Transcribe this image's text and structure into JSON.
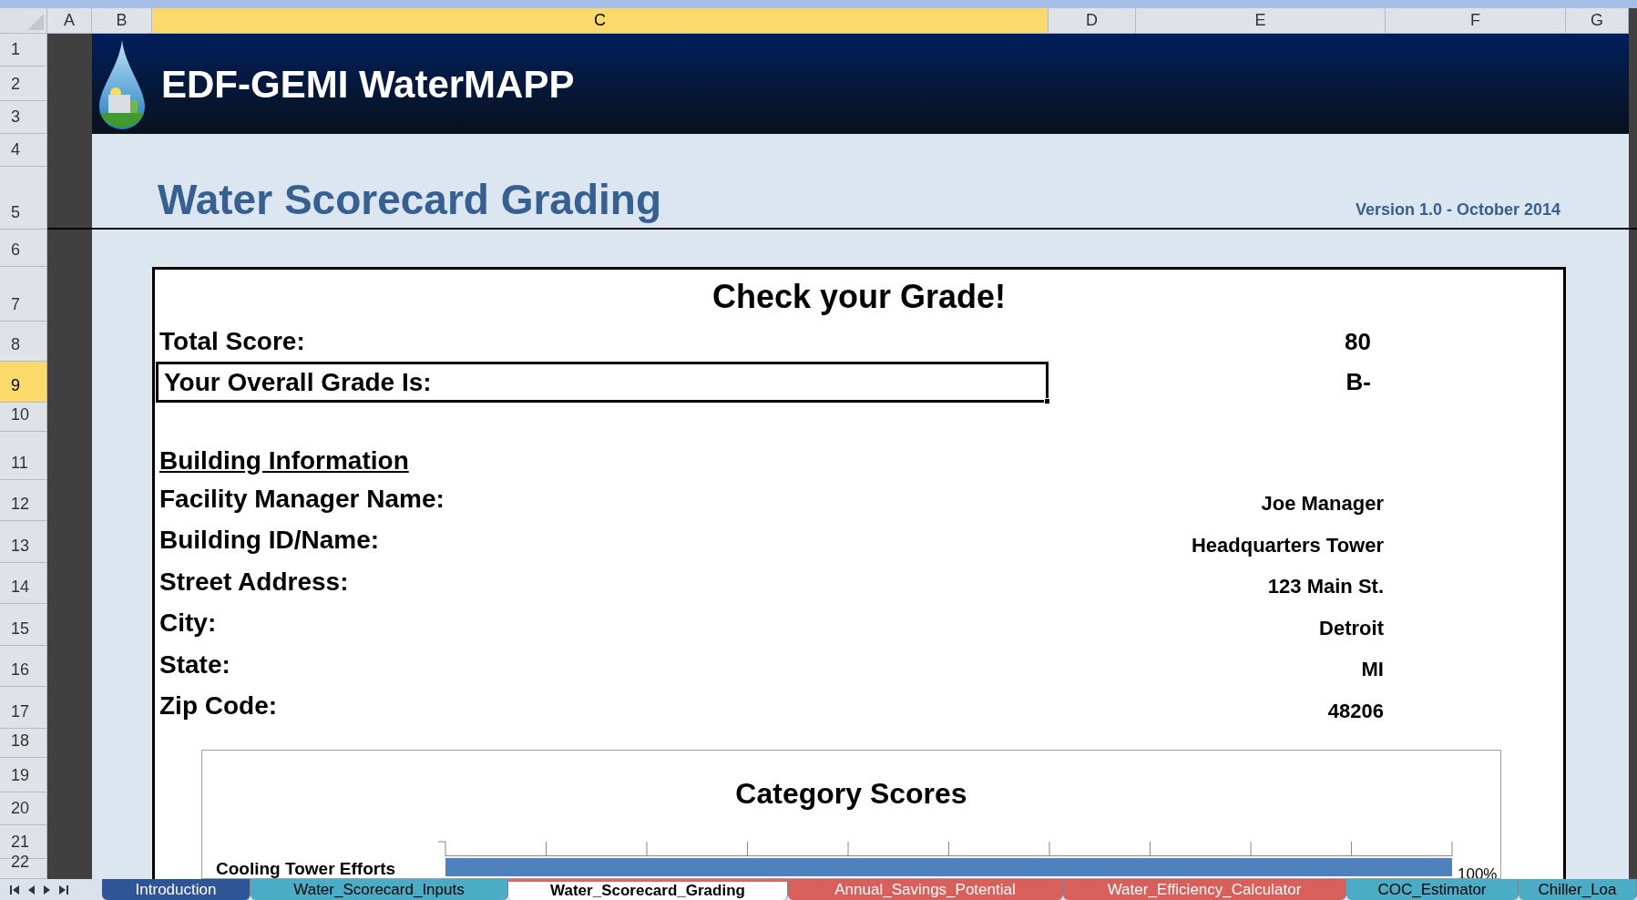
{
  "columns": [
    {
      "label": "A",
      "selected": false
    },
    {
      "label": "B",
      "selected": false
    },
    {
      "label": "C",
      "selected": true
    },
    {
      "label": "D",
      "selected": false
    },
    {
      "label": "E",
      "selected": false
    },
    {
      "label": "F",
      "selected": false
    },
    {
      "label": "G",
      "selected": false
    }
  ],
  "rows": [
    {
      "label": "1",
      "selected": false
    },
    {
      "label": "2",
      "selected": false
    },
    {
      "label": "3",
      "selected": false
    },
    {
      "label": "4",
      "selected": false
    },
    {
      "label": "5",
      "selected": false
    },
    {
      "label": "6",
      "selected": false
    },
    {
      "label": "7",
      "selected": false
    },
    {
      "label": "8",
      "selected": false
    },
    {
      "label": "9",
      "selected": true
    },
    {
      "label": "10",
      "selected": false
    },
    {
      "label": "11",
      "selected": false
    },
    {
      "label": "12",
      "selected": false
    },
    {
      "label": "13",
      "selected": false
    },
    {
      "label": "14",
      "selected": false
    },
    {
      "label": "15",
      "selected": false
    },
    {
      "label": "16",
      "selected": false
    },
    {
      "label": "17",
      "selected": false
    },
    {
      "label": "18",
      "selected": false
    },
    {
      "label": "19",
      "selected": false
    },
    {
      "label": "20",
      "selected": false
    },
    {
      "label": "21",
      "selected": false
    },
    {
      "label": "22",
      "selected": false
    }
  ],
  "banner": {
    "title": "EDF-GEMI WaterMAPP"
  },
  "page_title": "Water Scorecard Grading",
  "version": "Version 1.0 - October 2014",
  "grade_card": {
    "heading": "Check your Grade!",
    "total_score": {
      "label": "Total Score:",
      "value": "80"
    },
    "overall_grade": {
      "label": "Your Overall Grade Is:",
      "value": "B-",
      "selected": true
    }
  },
  "building_info": {
    "heading": "Building Information",
    "fields": [
      {
        "label": "Facility Manager Name:",
        "value": "Joe Manager"
      },
      {
        "label": "Building ID/Name:",
        "value": "Headquarters Tower"
      },
      {
        "label": "Street Address:",
        "value": "123 Main St."
      },
      {
        "label": "City:",
        "value": "Detroit"
      },
      {
        "label": "State:",
        "value": "MI"
      },
      {
        "label": "Zip Code:",
        "value": "48206"
      }
    ]
  },
  "chart": {
    "chart_data": {
      "type": "bar",
      "orientation": "horizontal",
      "title": "Category Scores",
      "categories": [
        "Cooling Tower Efforts"
      ],
      "values": [
        100
      ],
      "value_labels": [
        "100%"
      ]
    }
  },
  "sheet_tabs": [
    {
      "label": "Introduction",
      "selected": false,
      "color": "#2f5597"
    },
    {
      "label": "Water_Scorecard_Inputs",
      "selected": false,
      "color": "#4bacc6"
    },
    {
      "label": "Water_Scorecard_Grading",
      "selected": true,
      "color": "#e06666"
    },
    {
      "label": "Annual_Savings_Potential",
      "selected": false,
      "color": "#d9605a"
    },
    {
      "label": "Water_Efficiency_Calculator",
      "selected": false,
      "color": "#d9605a"
    },
    {
      "label": "COC_Estimator",
      "selected": false,
      "color": "#4bacc6"
    },
    {
      "label": "Chiller_Loa",
      "selected": false,
      "color": "#4bacc6"
    }
  ]
}
